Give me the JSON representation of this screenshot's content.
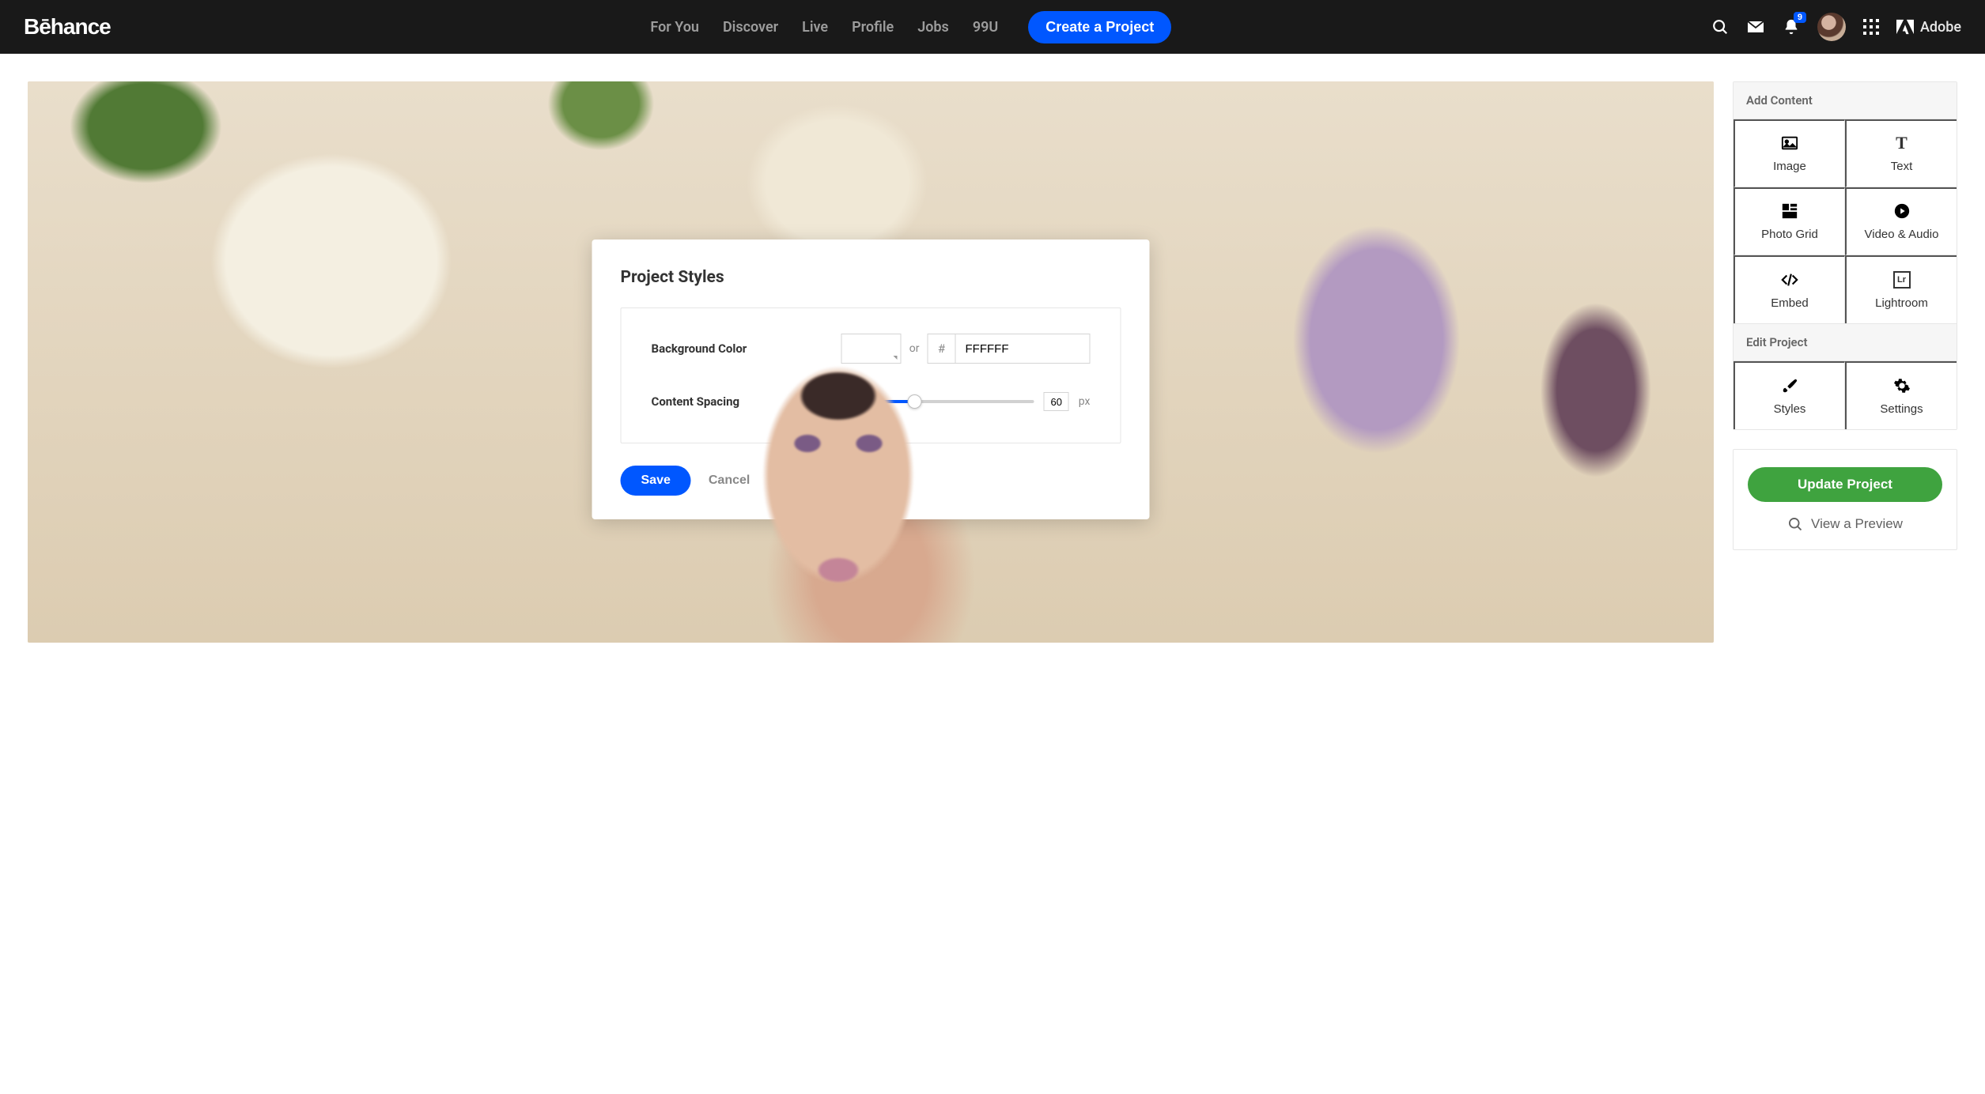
{
  "header": {
    "logo_text": "Bēhance",
    "nav": {
      "for_you": "For You",
      "discover": "Discover",
      "live": "Live",
      "profile": "Profile",
      "jobs": "Jobs",
      "ninenineu": "99U"
    },
    "cta": "Create a Project",
    "notification_count": "9",
    "adobe_label": "Adobe"
  },
  "modal": {
    "title": "Project Styles",
    "background_color_label": "Background Color",
    "or_label": "or",
    "hash": "#",
    "hex_value": "FFFFFF",
    "content_spacing_label": "Content Spacing",
    "spacing_value": "60",
    "spacing_unit": "px",
    "save": "Save",
    "cancel": "Cancel"
  },
  "sidebar": {
    "add_content_title": "Add Content",
    "tools": {
      "image": "Image",
      "text": "Text",
      "photo_grid": "Photo Grid",
      "video_audio": "Video & Audio",
      "embed": "Embed",
      "lightroom": "Lightroom",
      "lightroom_badge": "Lr"
    },
    "edit_project_title": "Edit Project",
    "edit": {
      "styles": "Styles",
      "settings": "Settings"
    },
    "update_button": "Update Project",
    "preview_button": "View a Preview"
  }
}
